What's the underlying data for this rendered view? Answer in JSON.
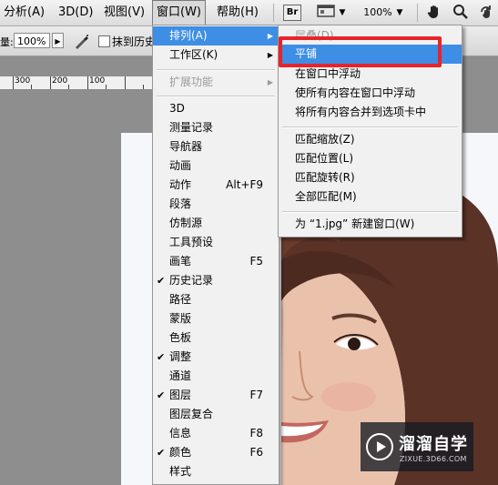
{
  "menubar": {
    "items": [
      "分析(A)",
      "3D(D)",
      "视图(V)",
      "窗口(W)",
      "帮助(H)"
    ],
    "br_label": "Br",
    "zoom": "100%"
  },
  "options": {
    "flow_label": "量:",
    "flow_value": "100%",
    "erase_history_label": "抹到历史"
  },
  "ruler": {
    "labels": [
      "300",
      "200",
      "100"
    ]
  },
  "window_menu": {
    "items": [
      {
        "label": "排列(A)",
        "submenu": true,
        "highlight": true
      },
      {
        "label": "工作区(K)",
        "submenu": true
      },
      {
        "label": "扩展功能",
        "submenu": true,
        "disabled": true
      },
      {
        "label": "3D"
      },
      {
        "label": "测量记录"
      },
      {
        "label": "导航器"
      },
      {
        "label": "动画"
      },
      {
        "label": "动作",
        "shortcut": "Alt+F9"
      },
      {
        "label": "段落"
      },
      {
        "label": "仿制源"
      },
      {
        "label": "工具预设"
      },
      {
        "label": "画笔",
        "shortcut": "F5"
      },
      {
        "label": "历史记录",
        "checked": true
      },
      {
        "label": "路径"
      },
      {
        "label": "蒙版"
      },
      {
        "label": "色板"
      },
      {
        "label": "调整",
        "checked": true
      },
      {
        "label": "通道"
      },
      {
        "label": "图层",
        "shortcut": "F7",
        "checked": true
      },
      {
        "label": "图层复合"
      },
      {
        "label": "信息",
        "shortcut": "F8"
      },
      {
        "label": "颜色",
        "shortcut": "F6",
        "checked": true
      },
      {
        "label": "样式"
      }
    ]
  },
  "arrange_menu": {
    "items": [
      {
        "label": "层叠(D)",
        "disabled": true
      },
      {
        "label": "平铺",
        "highlight": true
      },
      {
        "label": "在窗口中浮动"
      },
      {
        "label": "使所有内容在窗口中浮动"
      },
      {
        "label": "将所有内容合并到选项卡中"
      },
      {
        "label": "匹配缩放(Z)"
      },
      {
        "label": "匹配位置(L)"
      },
      {
        "label": "匹配旋转(R)"
      },
      {
        "label": "全部匹配(M)"
      },
      {
        "label": "为 “1.jpg” 新建窗口(W)"
      }
    ]
  },
  "watermark": {
    "title": "溜溜自学",
    "url": "ZIXUE.3D66.COM"
  },
  "colors": {
    "highlight": "#3d8ee4",
    "annotation": "#e8232a"
  }
}
